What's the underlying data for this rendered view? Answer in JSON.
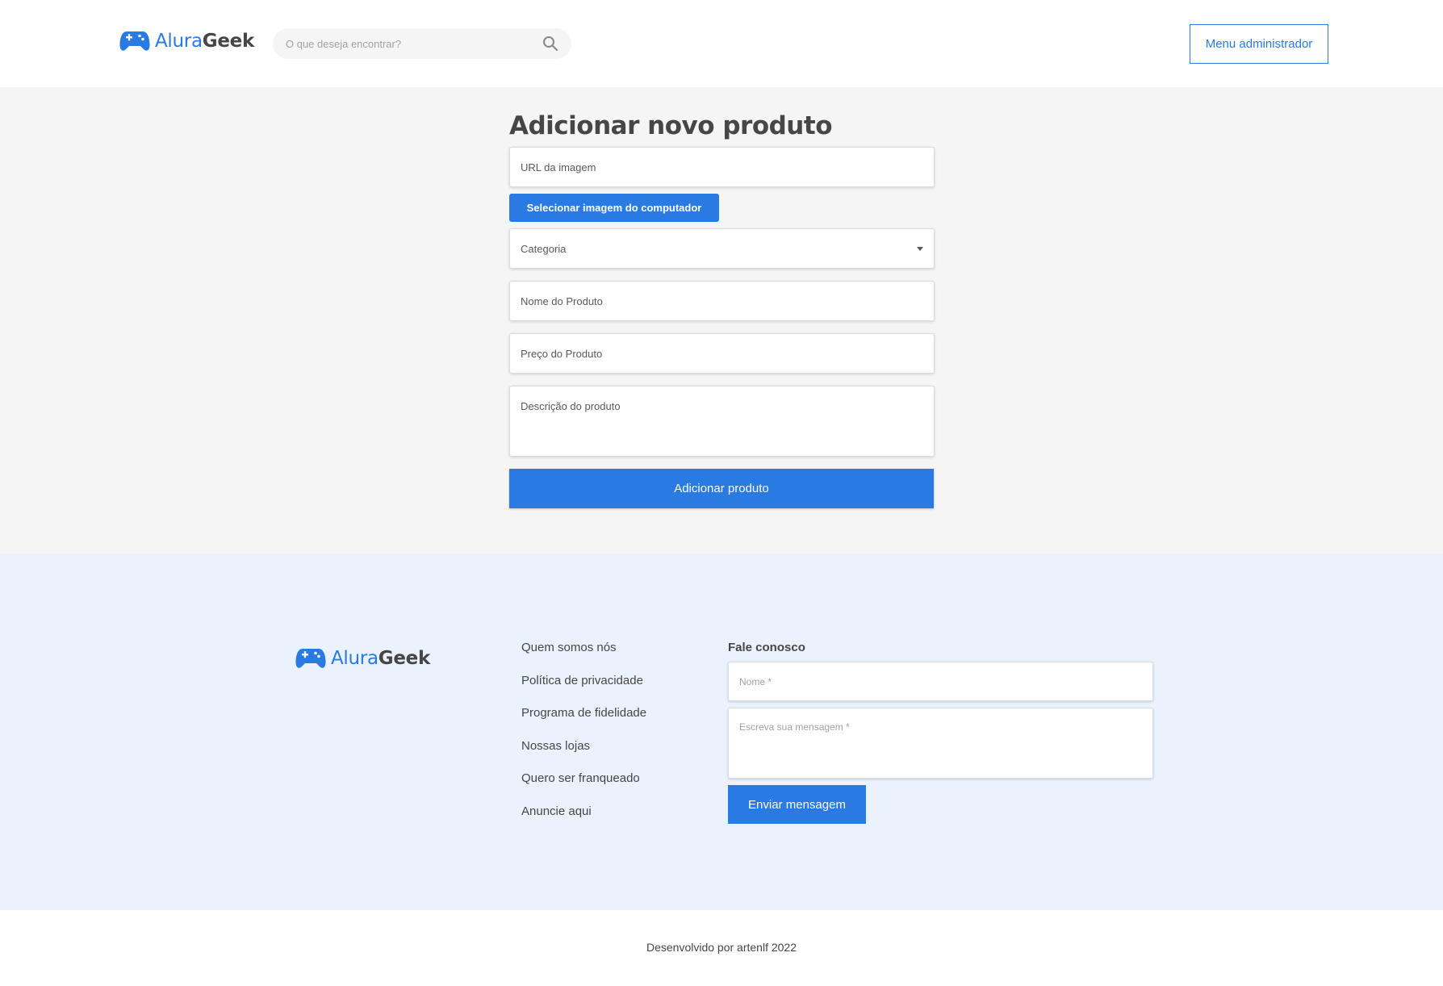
{
  "colors": {
    "accent": "#2a7ae4",
    "text": "#464646",
    "main_bg": "#f5f5f5",
    "footer_bg": "#eaf2fd"
  },
  "header": {
    "logo": {
      "icon": "gamepad-icon",
      "brand_part1": "Alura",
      "brand_part2": "Geek"
    },
    "search": {
      "placeholder": "O que deseja encontrar?",
      "icon": "search-icon"
    },
    "admin_button": "Menu administrador"
  },
  "form": {
    "title": "Adicionar novo produto",
    "image_url_placeholder": "URL da imagem",
    "upload_button": "Selecionar imagem do computador",
    "category_label": "Categoria",
    "name_placeholder": "Nome do Produto",
    "price_placeholder": "Preço do Produto",
    "description_placeholder": "Descrição do produto",
    "submit_button": "Adicionar produto"
  },
  "footer": {
    "logo": {
      "icon": "gamepad-icon",
      "brand_part1": "Alura",
      "brand_part2": "Geek"
    },
    "links": [
      "Quem somos nós",
      "Política de privacidade",
      "Programa de fidelidade",
      "Nossas lojas",
      "Quero ser franqueado",
      "Anuncie aqui"
    ],
    "contact": {
      "heading": "Fale conosco",
      "name_placeholder": "Nome *",
      "message_placeholder": "Escreva sua mensagem *",
      "send_button": "Enviar mensagem"
    }
  },
  "credits": "Desenvolvido por artenlf 2022"
}
